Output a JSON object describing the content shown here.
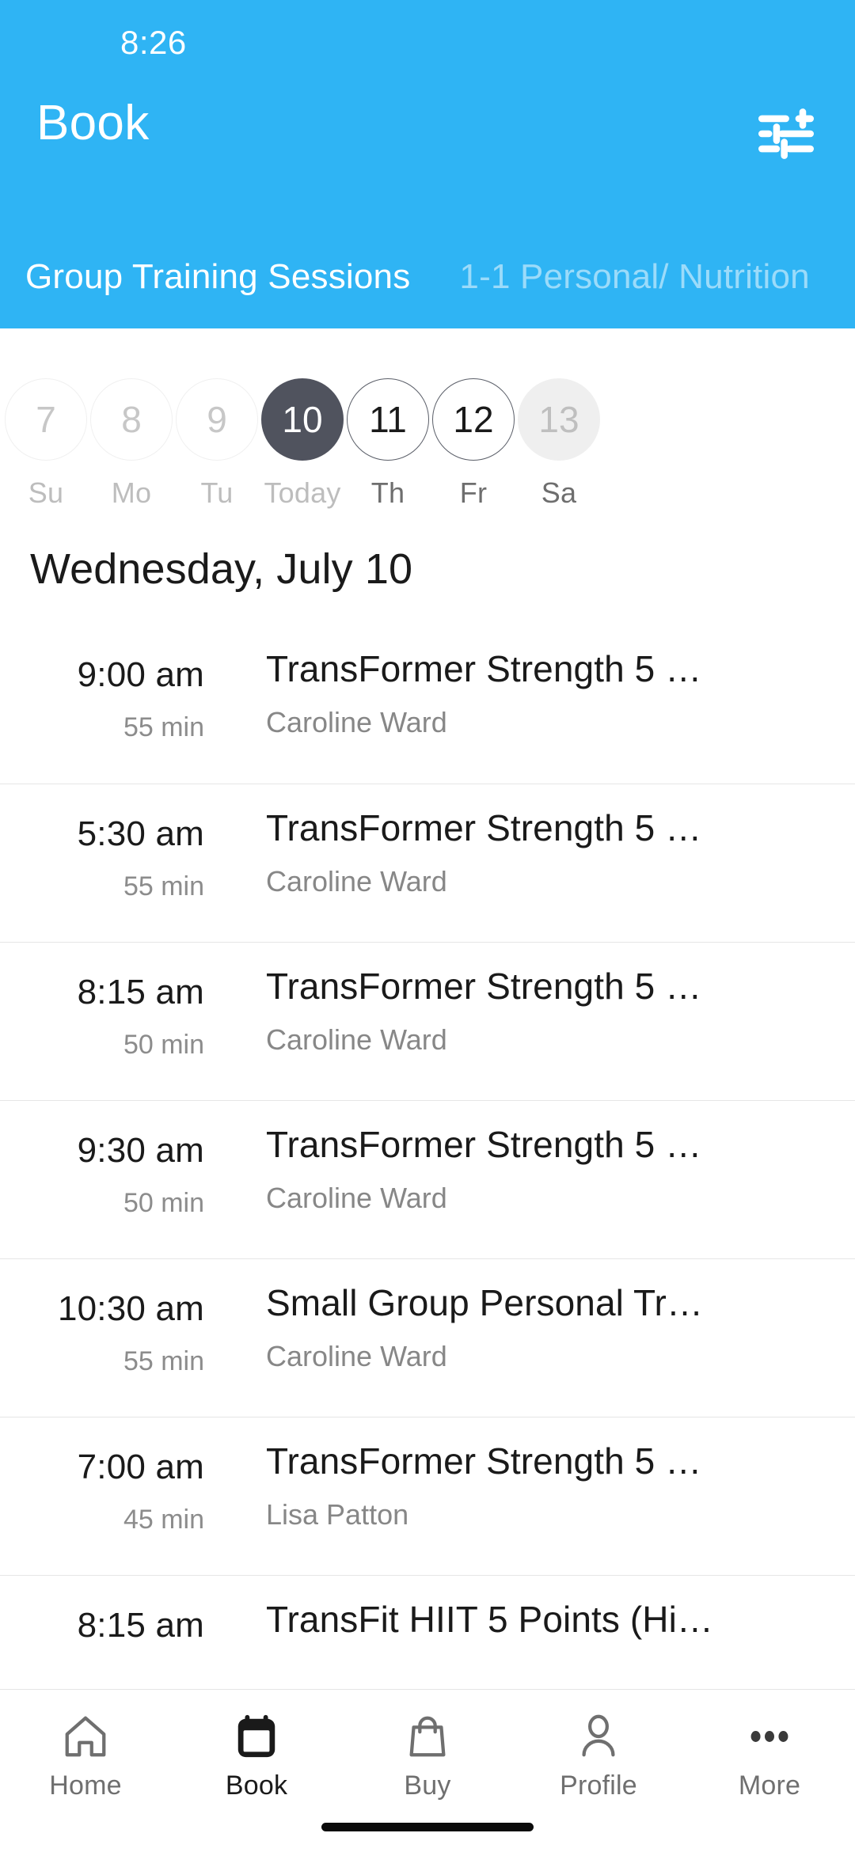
{
  "status_bar": {
    "time": "8:26"
  },
  "header": {
    "title": "Book",
    "filter_icon": "sliders-filter-icon",
    "accent_color": "#2FB4F4",
    "tabs": [
      {
        "label": "Group Training Sessions",
        "active": true
      },
      {
        "label": "1-1 Personal/ Nutrition",
        "active": false
      }
    ]
  },
  "date_strip": {
    "selected_color": "#50535E",
    "days": [
      {
        "num": "7",
        "dow": "Su",
        "state": "past"
      },
      {
        "num": "8",
        "dow": "Mo",
        "state": "past"
      },
      {
        "num": "9",
        "dow": "Tu",
        "state": "past"
      },
      {
        "num": "10",
        "dow": "Today",
        "state": "today"
      },
      {
        "num": "11",
        "dow": "Th",
        "state": "future"
      },
      {
        "num": "12",
        "dow": "Fr",
        "state": "future"
      },
      {
        "num": "13",
        "dow": "Sa",
        "state": "weekend"
      }
    ]
  },
  "day_heading": "Wednesday, July 10",
  "classes": [
    {
      "time": "9:00 am",
      "duration": "55 min",
      "name": "TransFormer Strength 5 …",
      "instructor": "Caroline Ward"
    },
    {
      "time": "5:30 am",
      "duration": "55 min",
      "name": "TransFormer Strength 5 …",
      "instructor": "Caroline Ward"
    },
    {
      "time": "8:15 am",
      "duration": "50 min",
      "name": "TransFormer Strength 5 …",
      "instructor": "Caroline Ward"
    },
    {
      "time": "9:30 am",
      "duration": "50 min",
      "name": "TransFormer Strength 5 …",
      "instructor": "Caroline Ward"
    },
    {
      "time": "10:30 am",
      "duration": "55 min",
      "name": "Small Group Personal Tr…",
      "instructor": "Caroline Ward"
    },
    {
      "time": "7:00 am",
      "duration": "45 min",
      "name": "TransFormer Strength 5 …",
      "instructor": "Lisa Patton"
    },
    {
      "time": "8:15 am",
      "duration": "",
      "name": "TransFit HIIT 5 Points (Hi…",
      "instructor": ""
    }
  ],
  "bottom_nav": [
    {
      "label": "Home",
      "icon": "home-icon",
      "active": false
    },
    {
      "label": "Book",
      "icon": "calendar-icon",
      "active": true
    },
    {
      "label": "Buy",
      "icon": "bag-icon",
      "active": false
    },
    {
      "label": "Profile",
      "icon": "person-icon",
      "active": false
    },
    {
      "label": "More",
      "icon": "dots-icon",
      "active": false
    }
  ]
}
